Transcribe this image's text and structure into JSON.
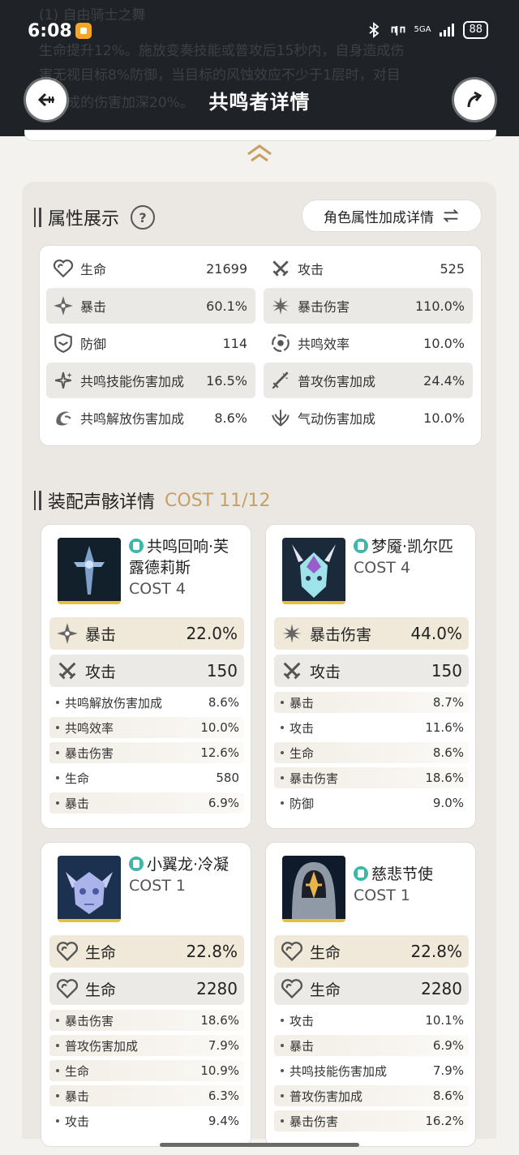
{
  "header": {
    "title": "共鸣者详情",
    "ghost_text": [
      "(1) 自由骑士之舞",
      "生命提升12%。施放变奏技能或普攻后15秒内，自身造成伤",
      "害无视目标8%防御，当目标的风蚀效应不少于1层时，对目",
      "标造成的伤害加深20%。"
    ]
  },
  "status_bar": {
    "time": "6:08",
    "network": "5GA",
    "battery": "88",
    "icons": [
      "bluetooth-icon",
      "headphones-icon",
      "signal-icon"
    ]
  },
  "attributes": {
    "title": "属性展示",
    "detail_button": "角色属性加成详情",
    "help_icon": "?",
    "stats": [
      {
        "label": "生命",
        "value": "21699",
        "icon": "hp-icon"
      },
      {
        "label": "攻击",
        "value": "525",
        "icon": "atk-swords-icon"
      },
      {
        "label": "暴击",
        "value": "60.1%",
        "icon": "crit-icon"
      },
      {
        "label": "暴击伤害",
        "value": "110.0%",
        "icon": "crit-dmg-icon"
      },
      {
        "label": "防御",
        "value": "114",
        "icon": "def-shield-icon"
      },
      {
        "label": "共鸣效率",
        "value": "10.0%",
        "icon": "energy-regen-icon"
      },
      {
        "label": "共鸣技能伤害加成",
        "value": "16.5%",
        "icon": "skill-dmg-icon"
      },
      {
        "label": "普攻伤害加成",
        "value": "24.4%",
        "icon": "basic-atk-icon"
      },
      {
        "label": "共鸣解放伤害加成",
        "value": "8.6%",
        "icon": "liberation-icon"
      },
      {
        "label": "气动伤害加成",
        "value": "10.0%",
        "icon": "aero-dmg-icon"
      }
    ]
  },
  "echoes": {
    "title": "装配声骸详情",
    "cost_total": "COST 11/12",
    "cards": [
      {
        "name": "共鸣回响·芙露德莉斯",
        "cost": "COST 4",
        "main": [
          {
            "label": "暴击",
            "value": "22.0%",
            "icon": "crit-icon"
          },
          {
            "label": "攻击",
            "value": "150",
            "icon": "atk-swords-icon"
          }
        ],
        "subs": [
          {
            "label": "共鸣解放伤害加成",
            "value": "8.6%"
          },
          {
            "label": "共鸣效率",
            "value": "10.0%"
          },
          {
            "label": "暴击伤害",
            "value": "12.6%"
          },
          {
            "label": "生命",
            "value": "580"
          },
          {
            "label": "暴击",
            "value": "6.9%"
          }
        ]
      },
      {
        "name": "梦魇·凯尔匹",
        "cost": "COST 4",
        "main": [
          {
            "label": "暴击伤害",
            "value": "44.0%",
            "icon": "crit-dmg-icon"
          },
          {
            "label": "攻击",
            "value": "150",
            "icon": "atk-swords-icon"
          }
        ],
        "subs": [
          {
            "label": "暴击",
            "value": "8.7%"
          },
          {
            "label": "攻击",
            "value": "11.6%"
          },
          {
            "label": "生命",
            "value": "8.6%"
          },
          {
            "label": "暴击伤害",
            "value": "18.6%"
          },
          {
            "label": "防御",
            "value": "9.0%"
          }
        ]
      },
      {
        "name": "小翼龙·冷凝",
        "cost": "COST 1",
        "main": [
          {
            "label": "生命",
            "value": "22.8%",
            "icon": "hp-icon"
          },
          {
            "label": "生命",
            "value": "2280",
            "icon": "hp-icon"
          }
        ],
        "subs": [
          {
            "label": "暴击伤害",
            "value": "18.6%"
          },
          {
            "label": "普攻伤害加成",
            "value": "7.9%"
          },
          {
            "label": "生命",
            "value": "10.9%"
          },
          {
            "label": "暴击",
            "value": "6.3%"
          },
          {
            "label": "攻击",
            "value": "9.4%"
          }
        ]
      },
      {
        "name": "慈悲节使",
        "cost": "COST 1",
        "main": [
          {
            "label": "生命",
            "value": "22.8%",
            "icon": "hp-icon"
          },
          {
            "label": "生命",
            "value": "2280",
            "icon": "hp-icon"
          }
        ],
        "subs": [
          {
            "label": "攻击",
            "value": "10.1%"
          },
          {
            "label": "暴击",
            "value": "6.9%"
          },
          {
            "label": "共鸣技能伤害加成",
            "value": "7.9%"
          },
          {
            "label": "普攻伤害加成",
            "value": "8.6%"
          },
          {
            "label": "暴击伤害",
            "value": "16.2%"
          }
        ]
      }
    ]
  },
  "colors": {
    "header_bg": "#1f2227",
    "gold": "#c79f62",
    "sonata": "#3cb7a8",
    "panel": "#ebe8e3"
  }
}
